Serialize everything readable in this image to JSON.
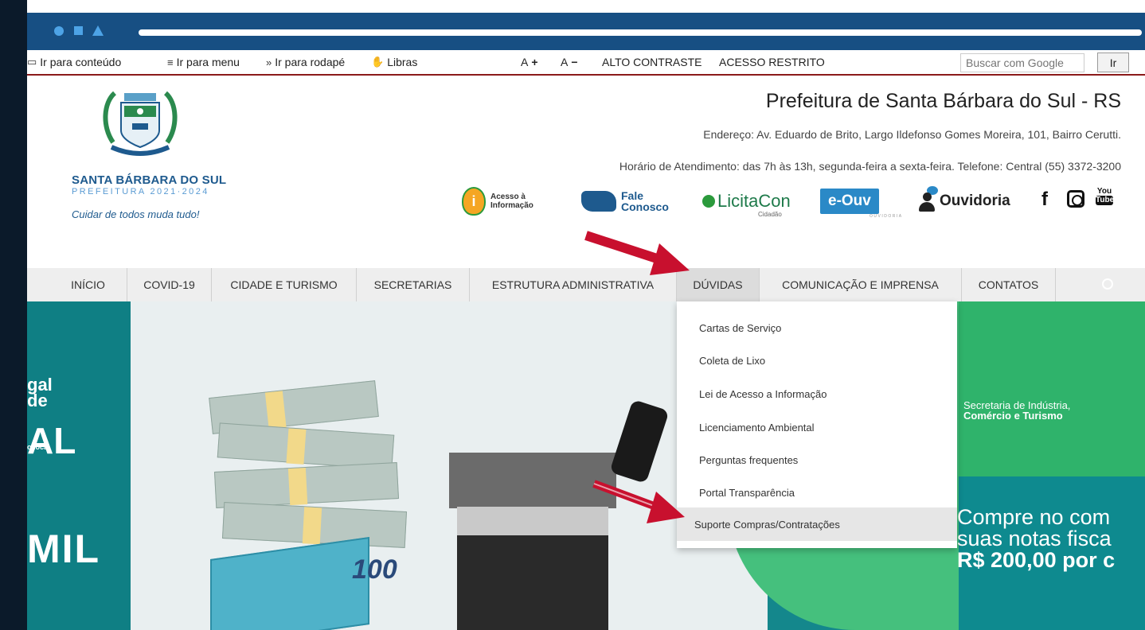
{
  "browser": {
    "accent": "#174f83"
  },
  "accessibility_bar": {
    "skip_content": "Ir para conteúdo",
    "skip_menu": "Ir para menu",
    "skip_footer": "Ir para rodapé",
    "libras": "Libras",
    "font_increase": "A",
    "font_decrease": "A",
    "high_contrast": "ALTO CONTRASTE",
    "restricted_access": "ACESSO RESTRITO",
    "search_placeholder": "Buscar com Google",
    "search_button": "Ir"
  },
  "header": {
    "logo_name": "SANTA BÁRBARA DO SUL",
    "logo_sub": "PREFEITURA 2021·2024",
    "logo_slogan": "Cuidar de todos muda tudo!",
    "title": "Prefeitura de Santa Bárbara do Sul - RS",
    "address": "Endereço: Av. Eduardo de Brito, Largo Ildefonso Gomes Moreira, 101, Bairro Cerutti.",
    "hours": "Horário de Atendimento: das 7h às 13h, segunda-feira a sexta-feira. Telefone: Central (55) 3372-3200"
  },
  "services": {
    "lai": "Acesso à\nInformação",
    "fale": "Fale\nConosco",
    "licitacon": "LicitaCon",
    "licitacon_sub": "Cidadão",
    "eouv": "e-Ouv",
    "eouv_sub": "OUVIDORIA",
    "ouvidoria": "Ouvidoria",
    "youtube_top": "You",
    "youtube_bottom": "Tube"
  },
  "nav": {
    "items": [
      {
        "label": "INÍCIO"
      },
      {
        "label": "COVID-19"
      },
      {
        "label": "CIDADE E TURISMO"
      },
      {
        "label": "SECRETARIAS"
      },
      {
        "label": "ESTRUTURA ADMINISTRATIVA"
      },
      {
        "label": "DÚVIDAS"
      },
      {
        "label": "COMUNICAÇÃO E IMPRENSA"
      },
      {
        "label": "CONTATOS"
      }
    ]
  },
  "dropdown": {
    "items": [
      {
        "label": "Cartas de Serviço"
      },
      {
        "label": "Coleta de Lixo"
      },
      {
        "label": "Lei de Acesso a Informação"
      },
      {
        "label": "Licenciamento Ambiental"
      },
      {
        "label": "Perguntas frequentes"
      },
      {
        "label": "Portal Transparência"
      },
      {
        "label": "Suporte Compras/Contratações"
      }
    ]
  },
  "hero": {
    "left_line1": "gal",
    "left_line2": "de",
    "left_big": "AL",
    "left_small": "o local",
    "mil": "MIL",
    "bill": "100",
    "secretaria_line1": "Secretaria de Indústria,",
    "secretaria_line2": "Comércio e Turismo",
    "compre_line1": "Compre no com",
    "compre_line2": "suas notas fisca",
    "compre_line3": "R$ 200,00 por c"
  },
  "colors": {
    "arrow": "#c8102e",
    "brand_blue": "#1e5a8e",
    "hero_teal": "#14878c"
  }
}
